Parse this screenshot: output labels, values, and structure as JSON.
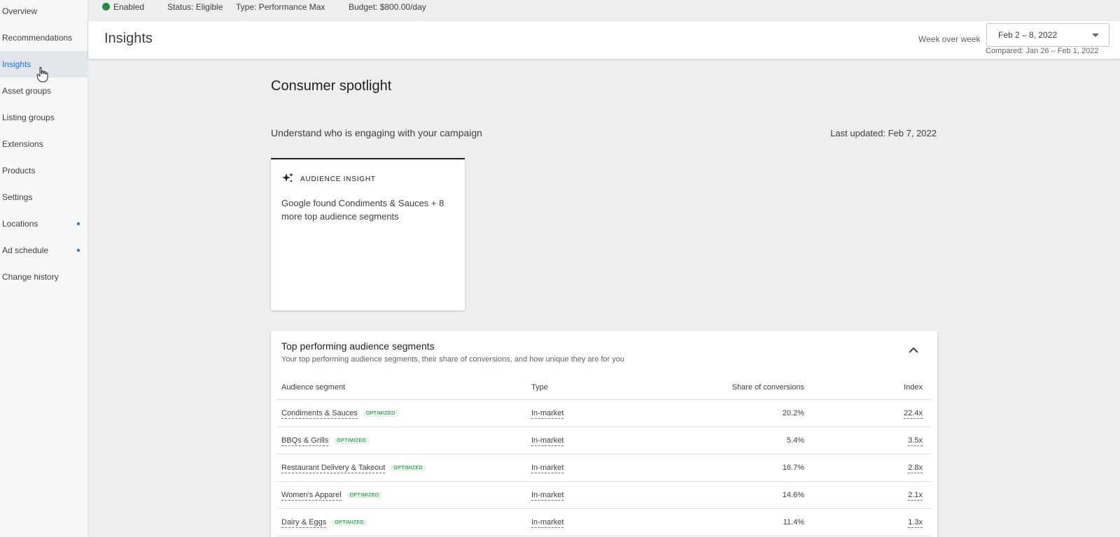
{
  "sidebar": {
    "items": [
      {
        "label": "Overview"
      },
      {
        "label": "Recommendations"
      },
      {
        "label": "Insights"
      },
      {
        "label": "Asset groups"
      },
      {
        "label": "Listing groups"
      },
      {
        "label": "Extensions"
      },
      {
        "label": "Products"
      },
      {
        "label": "Settings"
      },
      {
        "label": "Locations"
      },
      {
        "label": "Ad schedule"
      },
      {
        "label": "Change history"
      }
    ]
  },
  "status_bar": {
    "enabled": "Enabled",
    "status": "Status: Eligible",
    "type": "Type: Performance Max",
    "budget": "Budget: $800.00/day"
  },
  "header": {
    "title": "Insights",
    "compare_label": "Week over week",
    "date_range": "Feb 2 – 8, 2022",
    "compared": "Compared: Jan 26 – Feb 1, 2022"
  },
  "main": {
    "title": "Consumer spotlight",
    "subtitle": "Understand who is engaging with your campaign",
    "last_updated": "Last updated: Feb 7, 2022"
  },
  "insight_card": {
    "label": "AUDIENCE INSIGHT",
    "text": "Google found Condiments & Sauces + 8 more top audience segments"
  },
  "segments_table": {
    "title": "Top performing audience segments",
    "subtitle": "Your top performing audience segments, their share of conversions, and how unique they are for you",
    "columns": [
      "Audience segment",
      "Type",
      "Share of conversions",
      "Index"
    ],
    "badge": "OPTIMIZED",
    "rows": [
      {
        "segment": "Condiments & Sauces",
        "type": "In-market",
        "share": "20.2%",
        "index": "22.4x"
      },
      {
        "segment": "BBQs & Grills",
        "type": "In-market",
        "share": "5.4%",
        "index": "3.5x"
      },
      {
        "segment": "Restaurant Delivery & Takeout",
        "type": "In-market",
        "share": "16.7%",
        "index": "2.8x"
      },
      {
        "segment": "Women's Apparel",
        "type": "In-market",
        "share": "14.6%",
        "index": "2.1x"
      },
      {
        "segment": "Dairy & Eggs",
        "type": "In-market",
        "share": "11.4%",
        "index": "1.3x"
      }
    ]
  },
  "colors": {
    "accent": "#1a73e8",
    "enabled_green": "#1e8e3e",
    "badge_bg": "#e6f4ea",
    "badge_text": "#188038"
  },
  "icons": {
    "status": "green-dot-icon",
    "insight": "sparkle-icon",
    "collapse": "chevron-up-icon",
    "dropdown": "caret-down-icon",
    "pointer": "hand-pointer-icon"
  }
}
